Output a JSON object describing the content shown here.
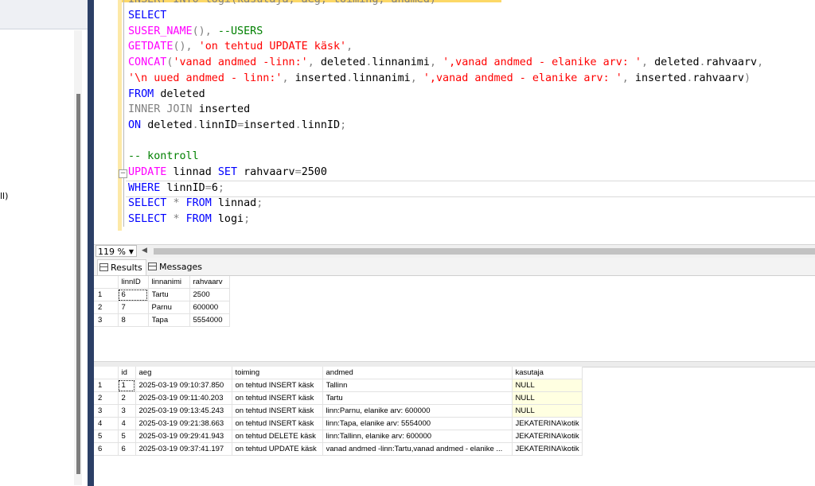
{
  "left_panel": {
    "truncated_text": "ll)"
  },
  "editor": {
    "clipped_top_line": "INSERT INTO logi(kasutaja, aeg, toiming, andmed)",
    "lines": [
      [
        {
          "t": "SELECT",
          "c": "kw"
        }
      ],
      [
        {
          "t": "SUSER_NAME",
          "c": "fn"
        },
        {
          "t": "(), ",
          "c": "gray"
        },
        {
          "t": "--USERS",
          "c": "cm"
        }
      ],
      [
        {
          "t": "GETDATE",
          "c": "fn"
        },
        {
          "t": "(), ",
          "c": "gray"
        },
        {
          "t": "'on tehtud UPDATE käsk'",
          "c": "str"
        },
        {
          "t": ",",
          "c": "gray"
        }
      ],
      [
        {
          "t": "CONCAT",
          "c": "fn"
        },
        {
          "t": "(",
          "c": "gray"
        },
        {
          "t": "'vanad andmed -linn:'",
          "c": "str"
        },
        {
          "t": ", ",
          "c": "gray"
        },
        {
          "t": "deleted",
          "c": ""
        },
        {
          "t": ".",
          "c": "gray"
        },
        {
          "t": "linnanimi",
          "c": ""
        },
        {
          "t": ", ",
          "c": "gray"
        },
        {
          "t": "',vanad andmed - elanike arv: '",
          "c": "str"
        },
        {
          "t": ", ",
          "c": "gray"
        },
        {
          "t": "deleted",
          "c": ""
        },
        {
          "t": ".",
          "c": "gray"
        },
        {
          "t": "rahvaarv",
          "c": ""
        },
        {
          "t": ",",
          "c": "gray"
        }
      ],
      [
        {
          "t": "'\\n uued andmed - linn:'",
          "c": "str"
        },
        {
          "t": ", ",
          "c": "gray"
        },
        {
          "t": "inserted",
          "c": ""
        },
        {
          "t": ".",
          "c": "gray"
        },
        {
          "t": "linnanimi",
          "c": ""
        },
        {
          "t": ", ",
          "c": "gray"
        },
        {
          "t": "',vanad andmed - elanike arv: '",
          "c": "str"
        },
        {
          "t": ", ",
          "c": "gray"
        },
        {
          "t": "inserted",
          "c": ""
        },
        {
          "t": ".",
          "c": "gray"
        },
        {
          "t": "rahvaarv",
          "c": ""
        },
        {
          "t": ")",
          "c": "gray"
        }
      ],
      [
        {
          "t": "FROM ",
          "c": "kw"
        },
        {
          "t": "deleted",
          "c": ""
        }
      ],
      [
        {
          "t": "INNER JOIN ",
          "c": "gray"
        },
        {
          "t": "inserted",
          "c": ""
        }
      ],
      [
        {
          "t": "ON ",
          "c": "kw"
        },
        {
          "t": "deleted",
          "c": ""
        },
        {
          "t": ".",
          "c": "gray"
        },
        {
          "t": "linnID",
          "c": ""
        },
        {
          "t": "=",
          "c": "gray"
        },
        {
          "t": "inserted",
          "c": ""
        },
        {
          "t": ".",
          "c": "gray"
        },
        {
          "t": "linnID",
          "c": ""
        },
        {
          "t": ";",
          "c": "gray"
        }
      ],
      [],
      [
        {
          "t": "-- kontroll",
          "c": "cm"
        }
      ],
      [
        {
          "t": "UPDATE ",
          "c": "fn"
        },
        {
          "t": "linnad ",
          "c": ""
        },
        {
          "t": "SET ",
          "c": "kw"
        },
        {
          "t": "rahvaarv",
          "c": ""
        },
        {
          "t": "=",
          "c": "gray"
        },
        {
          "t": "2500",
          "c": ""
        }
      ],
      [
        {
          "t": "WHERE ",
          "c": "kw"
        },
        {
          "t": "linnID",
          "c": ""
        },
        {
          "t": "=",
          "c": "gray"
        },
        {
          "t": "6",
          "c": ""
        },
        {
          "t": ";",
          "c": "gray"
        }
      ],
      [
        {
          "t": "SELECT ",
          "c": "kw"
        },
        {
          "t": "* ",
          "c": "gray"
        },
        {
          "t": "FROM ",
          "c": "kw"
        },
        {
          "t": "linnad",
          "c": ""
        },
        {
          "t": ";",
          "c": "gray"
        }
      ],
      [
        {
          "t": "SELECT ",
          "c": "kw"
        },
        {
          "t": "* ",
          "c": "gray"
        },
        {
          "t": "FROM ",
          "c": "kw"
        },
        {
          "t": "logi",
          "c": ""
        },
        {
          "t": ";",
          "c": "gray"
        }
      ]
    ]
  },
  "zoom": {
    "value": "119 %"
  },
  "tabs": {
    "results": "Results",
    "messages": "Messages"
  },
  "grid1": {
    "columns": [
      "linnID",
      "linnanimi",
      "rahvaarv"
    ],
    "rows": [
      [
        "1",
        "6",
        "Tartu",
        "2500"
      ],
      [
        "2",
        "7",
        "Parnu",
        "600000"
      ],
      [
        "3",
        "8",
        "Tapa",
        "5554000"
      ]
    ]
  },
  "grid2": {
    "columns": [
      "id",
      "aeg",
      "toiming",
      "andmed",
      "kasutaja"
    ],
    "rows": [
      [
        "1",
        "1",
        "2025-03-19 09:10:37.850",
        "on tehtud INSERT käsk",
        "Tallinn",
        "NULL"
      ],
      [
        "2",
        "2",
        "2025-03-19 09:11:40.203",
        "on tehtud INSERT käsk",
        "Tartu",
        "NULL"
      ],
      [
        "3",
        "3",
        "2025-03-19 09:13:45.243",
        "on tehtud INSERT käsk",
        "linn:Parnu, elanike arv: 600000",
        "NULL"
      ],
      [
        "4",
        "4",
        "2025-03-19 09:21:38.663",
        "on tehtud INSERT käsk",
        "linn:Tapa, elanike arv: 5554000",
        "JEKATERINA\\kotik"
      ],
      [
        "5",
        "5",
        "2025-03-19 09:29:41.943",
        "on tehtud DELETE käsk",
        "linn:Tallinn, elanike arv: 600000",
        "JEKATERINA\\kotik"
      ],
      [
        "6",
        "6",
        "2025-03-19 09:37:41.197",
        "on tehtud UPDATE käsk",
        "vanad andmed -linn:Tartu,vanad andmed - elanike ...",
        "JEKATERINA\\kotik"
      ]
    ]
  }
}
